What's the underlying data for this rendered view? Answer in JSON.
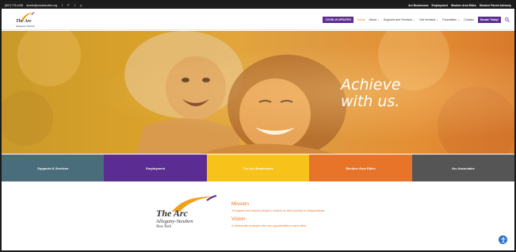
{
  "topbar": {
    "phone": "(607) 776-4136",
    "email": "arcinfo@arcofsteuben.org",
    "social_icons": [
      "facebook-icon",
      "pinterest-icon",
      "twitter-icon",
      "instagram-icon"
    ],
    "right_links": [
      "Arc Businesses",
      "Employment",
      "Steuben Area Rides",
      "Steuben Parent Advisory"
    ]
  },
  "header": {
    "logo_name": "The Arc",
    "logo_sub": "Allegany-Steuben",
    "covid_label": "COVID-19 UPDATES",
    "nav": [
      "Home",
      "About",
      "Supports and Services",
      "Get Involved",
      "Foundation",
      "Contact"
    ],
    "donate_label": "Donate Today!"
  },
  "hero": {
    "line1": "Achieve",
    "line2": "with us."
  },
  "tiles": [
    {
      "label": "Supports & Services",
      "color": "#4a6d7c"
    },
    {
      "label": "Employment",
      "color": "#5b2c91"
    },
    {
      "label": "The Arc Businesses",
      "color": "#f7c21a"
    },
    {
      "label": "Steuben Area Rides",
      "color": "#e8742a"
    },
    {
      "label": "Arc Associates",
      "color": "#555555"
    }
  ],
  "about": {
    "logo_name": "The Arc",
    "logo_sub1": "Allegany-Steuben",
    "logo_sub2": "New York",
    "mission_title": "Mission",
    "mission_text": "To support and respect people's choices on their journey to independence.",
    "vision_title": "Vision",
    "vision_text": "A community of people who see opportunities in each other."
  },
  "colors": {
    "accent": "#e8742a",
    "brand_purple": "#5b2c91",
    "accessibility_blue": "#2a73c9"
  }
}
